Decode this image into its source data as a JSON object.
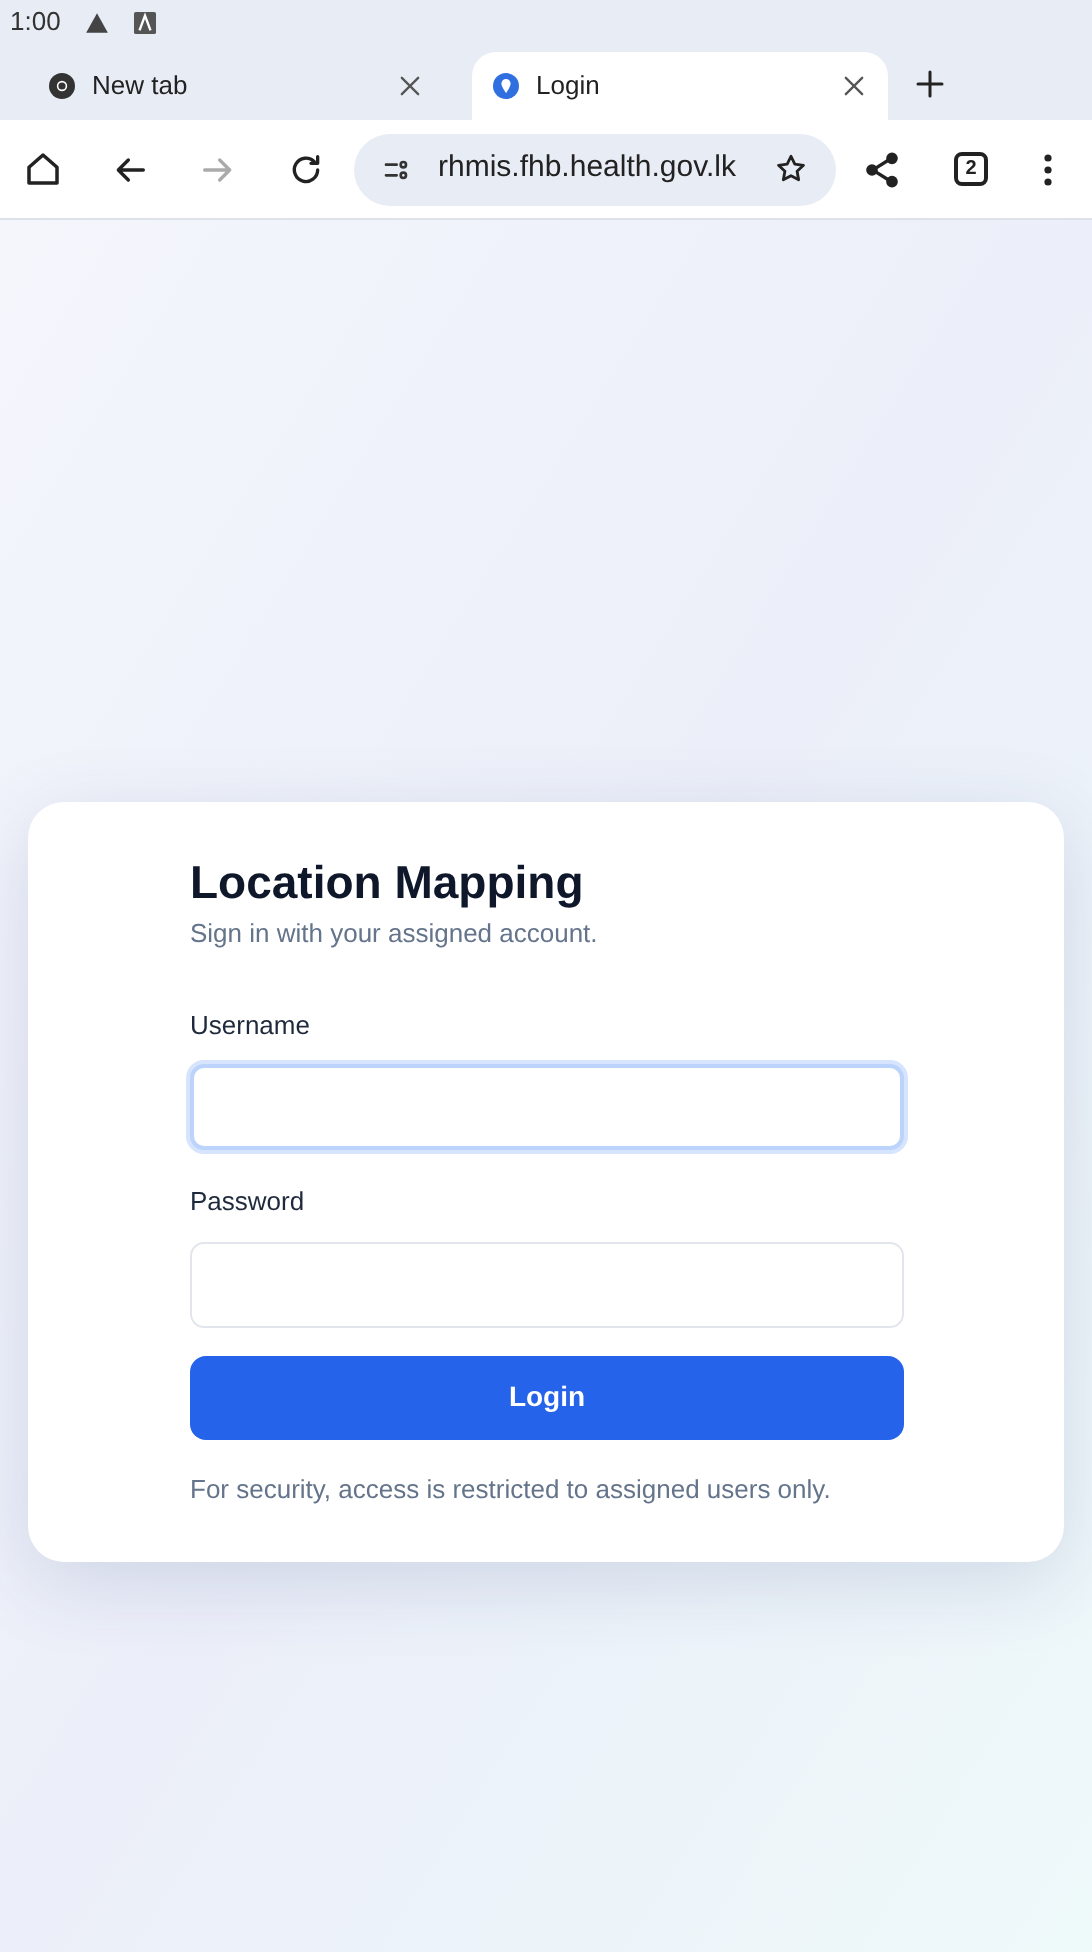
{
  "status_bar": {
    "time": "1:00"
  },
  "tabs": [
    {
      "title": "New tab",
      "selected": false,
      "kind": "newtab"
    },
    {
      "title": "Login",
      "selected": true,
      "kind": "site"
    }
  ],
  "toolbar": {
    "url": "rhmis.fhb.health.gov.lk",
    "tab_count": "2"
  },
  "login": {
    "title": "Location Mapping",
    "subtitle": "Sign in with your assigned account.",
    "fields": [
      {
        "label": "Username",
        "focused": true
      },
      {
        "label": "Password",
        "focused": false
      }
    ],
    "button": "Login",
    "note": "For security, access is restricted to assigned users only."
  }
}
